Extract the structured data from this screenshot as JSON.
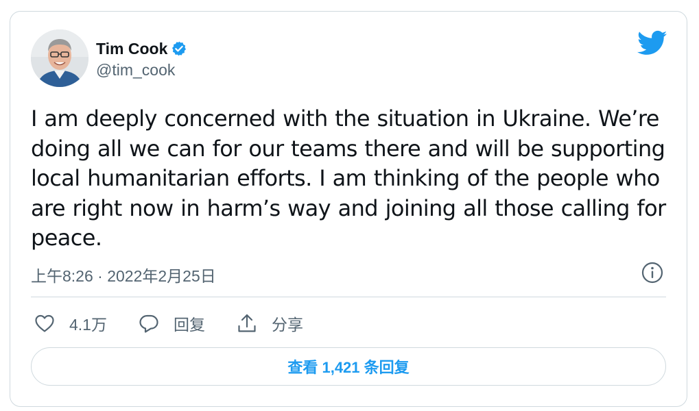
{
  "author": {
    "name": "Tim Cook",
    "handle": "@tim_cook",
    "verified": true
  },
  "tweet": {
    "text": "I am deeply concerned with the situation in Ukraine. We’re doing all we can for our teams there and will be supporting local humanitarian efforts. I am thinking of the people who are right now in harm’s way and joining all those calling for peace.",
    "timestamp": "上午8:26 · 2022年2月25日"
  },
  "actions": {
    "like_count": "4.1万",
    "reply_label": "回复",
    "share_label": "分享"
  },
  "view_replies_label": "查看 1,421 条回复",
  "icons": {
    "brand": "twitter-bird-icon",
    "verified": "verified-badge-icon",
    "info": "info-icon",
    "like": "heart-icon",
    "reply": "speech-bubble-icon",
    "share": "share-upload-icon"
  },
  "colors": {
    "accent": "#1d9bf0",
    "text_primary": "#0f1419",
    "text_secondary": "#536471",
    "border": "#cfd9de"
  }
}
